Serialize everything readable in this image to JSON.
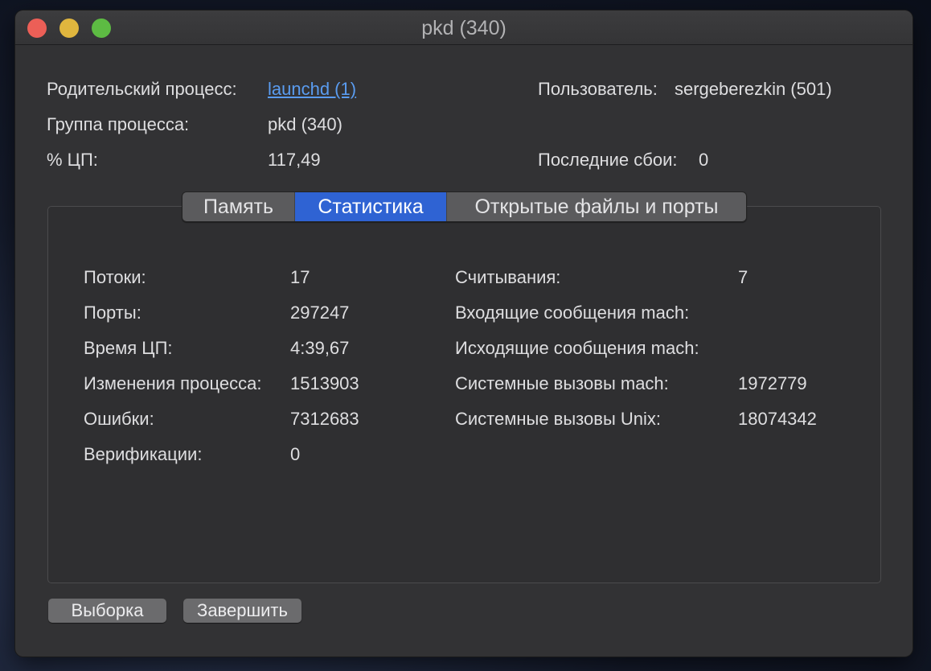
{
  "window": {
    "title": "pkd (340)"
  },
  "info": {
    "parent_label": "Родительский процесс:",
    "parent_value": "launchd (1)",
    "group_label": "Группа процесса:",
    "group_value": "pkd (340)",
    "cpu_label": "% ЦП:",
    "cpu_value": "117,49",
    "user_label": "Пользователь:",
    "user_value": "sergeberezkin (501)",
    "crashes_label": "Последние сбои:",
    "crashes_value": "0"
  },
  "tabs": [
    {
      "label": "Память",
      "active": false
    },
    {
      "label": "Статистика",
      "active": true
    },
    {
      "label": "Открытые файлы и порты",
      "active": false
    }
  ],
  "stats": {
    "left": [
      {
        "label": "Потоки:",
        "value": "17"
      },
      {
        "label": "Порты:",
        "value": "297247"
      },
      {
        "label": "Время ЦП:",
        "value": "4:39,67"
      },
      {
        "label": "Изменения процесса:",
        "value": "1513903"
      },
      {
        "label": "Ошибки:",
        "value": "7312683"
      },
      {
        "label": "Верификации:",
        "value": "0"
      }
    ],
    "right": [
      {
        "label": "Считывания:",
        "value": "7"
      },
      {
        "label": "Входящие сообщения mach:",
        "value": ""
      },
      {
        "label": "Исходящие сообщения mach:",
        "value": ""
      },
      {
        "label": "Системные вызовы mach:",
        "value": "1972779"
      },
      {
        "label": "Системные вызовы Unix:",
        "value": "18074342"
      }
    ]
  },
  "buttons": {
    "sample_label": "Выборка",
    "quit_label": "Завершить"
  },
  "colors": {
    "accent": "#2f63d3",
    "link": "#5a9cf0",
    "window_bg": "#323234"
  }
}
